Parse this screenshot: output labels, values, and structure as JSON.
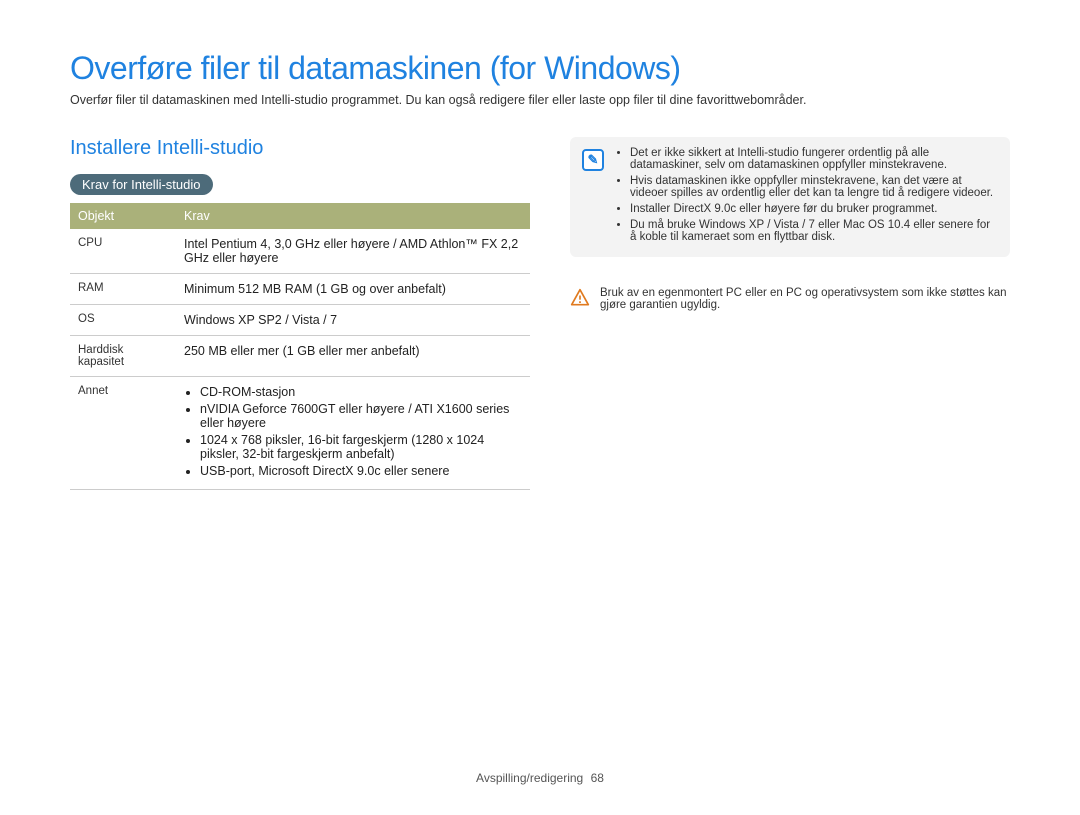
{
  "title": "Overføre filer til datamaskinen (for Windows)",
  "intro": "Overfør filer til datamaskinen med Intelli-studio programmet. Du kan også redigere filer eller laste opp filer til dine favorittwebområder.",
  "section_title": "Installere Intelli-studio",
  "pill": "Krav for Intelli-studio",
  "table": {
    "headers": {
      "col1": "Objekt",
      "col2": "Krav"
    },
    "rows": {
      "cpu": {
        "label": "CPU",
        "value": "Intel Pentium 4, 3,0 GHz eller høyere / AMD Athlon™ FX 2,2 GHz eller høyere"
      },
      "ram": {
        "label": "RAM",
        "value": "Minimum 512 MB RAM (1 GB og over anbefalt)"
      },
      "os": {
        "label": "OS",
        "value": "Windows XP SP2 / Vista / 7"
      },
      "hdd": {
        "label": "Harddisk kapasitet",
        "value": "250 MB eller mer (1 GB eller mer anbefalt)"
      },
      "other": {
        "label": "Annet",
        "items": [
          "CD-ROM-stasjon",
          "nVIDIA Geforce 7600GT eller høyere / ATI X1600 series eller høyere",
          "1024 x 768 piksler, 16-bit fargeskjerm (1280 x 1024 piksler, 32-bit fargeskjerm anbefalt)",
          "USB-port, Microsoft DirectX 9.0c eller senere"
        ]
      }
    }
  },
  "note": {
    "items": [
      "Det er ikke sikkert at Intelli-studio fungerer ordentlig på alle datamaskiner, selv om datamaskinen oppfyller minstekravene.",
      "Hvis datamaskinen ikke oppfyller minstekravene, kan det være at videoer spilles av ordentlig eller det kan ta lengre tid å redigere videoer.",
      "Installer DirectX 9.0c eller høyere før du bruker programmet.",
      "Du må bruke Windows XP / Vista / 7 eller Mac OS 10.4 eller senere for å koble til kameraet som en flyttbar disk."
    ]
  },
  "warning": "Bruk av en egenmontert PC eller en PC og operativsystem som ikke støttes kan gjøre garantien ugyldig.",
  "footer": {
    "text": "Avspilling/redigering",
    "page": "68"
  }
}
